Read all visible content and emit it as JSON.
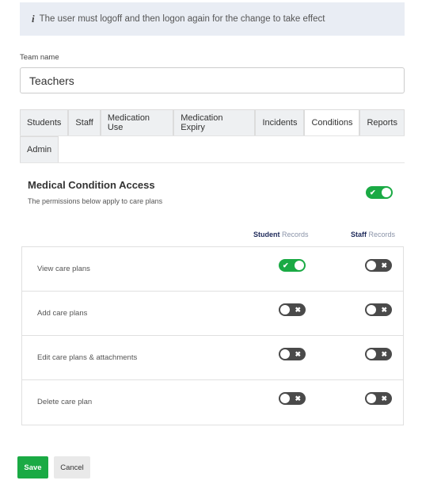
{
  "info": {
    "icon": "info-icon",
    "text": "The user must logoff and then logon again for the change to take effect"
  },
  "team": {
    "label": "Team name",
    "value": "Teachers"
  },
  "tabs": [
    {
      "label": "Students"
    },
    {
      "label": "Staff"
    },
    {
      "label": "Medication Use"
    },
    {
      "label": "Medication Expiry"
    },
    {
      "label": "Incidents"
    },
    {
      "label": "Conditions",
      "active": true
    },
    {
      "label": "Reports"
    },
    {
      "label": "Admin"
    }
  ],
  "section": {
    "title": "Medical Condition Access",
    "subtitle": "The permissions below apply to care plans",
    "enabled": true
  },
  "columns": {
    "student_bold": "Student",
    "student_rest": " Records",
    "staff_bold": "Staff",
    "staff_rest": " Records"
  },
  "rows": [
    {
      "label": "View care plans",
      "student": true,
      "staff": false
    },
    {
      "label": "Add care plans",
      "student": false,
      "staff": false
    },
    {
      "label": "Edit care plans & attachments",
      "student": false,
      "staff": false
    },
    {
      "label": "Delete care plan",
      "student": false,
      "staff": false
    }
  ],
  "buttons": {
    "save": "Save",
    "cancel": "Cancel"
  },
  "colors": {
    "accent": "#1aaa44",
    "toggle_off": "#4a4a4a"
  }
}
